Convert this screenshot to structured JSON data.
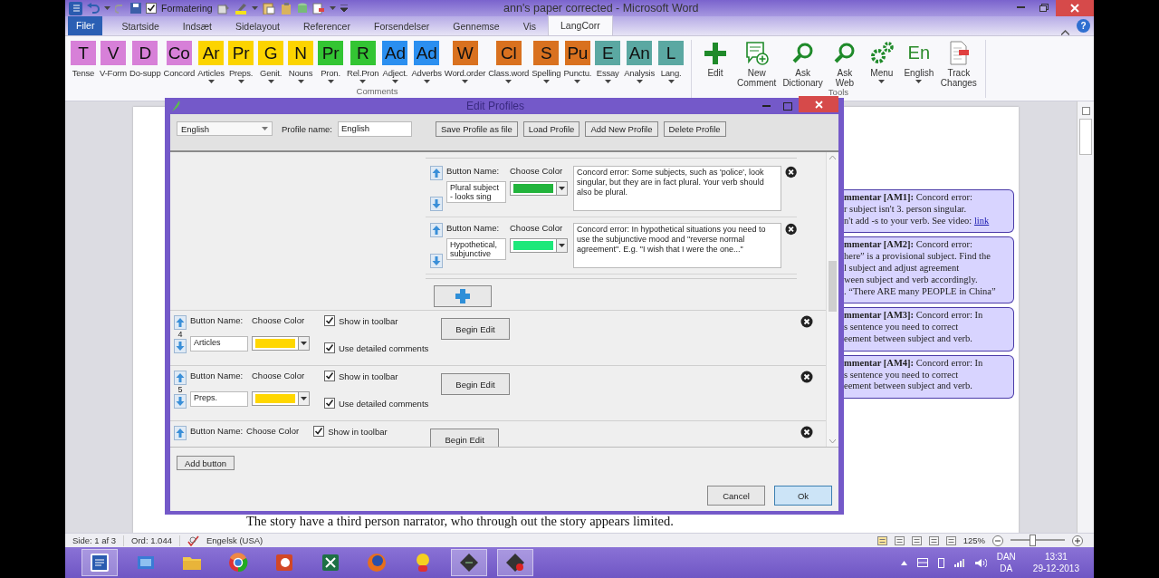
{
  "titlebar": {
    "qat_label": "Formatering",
    "qat_checked": true,
    "title": "ann's paper corrected  -  Microsoft Word"
  },
  "tabs": [
    {
      "label": "Filer",
      "kind": "file",
      "selected": false
    },
    {
      "label": "Startside",
      "kind": "tab",
      "selected": false
    },
    {
      "label": "Indsæt",
      "kind": "tab",
      "selected": false
    },
    {
      "label": "Sidelayout",
      "kind": "tab",
      "selected": false
    },
    {
      "label": "Referencer",
      "kind": "tab",
      "selected": false
    },
    {
      "label": "Forsendelser",
      "kind": "tab",
      "selected": false
    },
    {
      "label": "Gennemse",
      "kind": "tab",
      "selected": false
    },
    {
      "label": "Vis",
      "kind": "tab",
      "selected": false
    },
    {
      "label": "LangCorr",
      "kind": "tab",
      "selected": true
    }
  ],
  "help": "?",
  "ribbon": {
    "comments_group": "Comments",
    "tools_group": "Tools",
    "comment_buttons": [
      {
        "letter": "T",
        "label": "Tense",
        "color": "#d780d8",
        "dropdown": false
      },
      {
        "letter": "V",
        "label": "V-Form",
        "color": "#d780d8",
        "dropdown": false
      },
      {
        "letter": "D",
        "label": "Do-supp",
        "color": "#d780d8",
        "dropdown": false
      },
      {
        "letter": "Co",
        "label": "Concord",
        "color": "#d780d8",
        "dropdown": false
      },
      {
        "letter": "Ar",
        "label": "Articles",
        "color": "#fcd400",
        "dropdown": true
      },
      {
        "letter": "Pr",
        "label": "Preps.",
        "color": "#fcd400",
        "dropdown": true
      },
      {
        "letter": "G",
        "label": "Genit.",
        "color": "#fcd400",
        "dropdown": true
      },
      {
        "letter": "N",
        "label": "Nouns",
        "color": "#fcd400",
        "dropdown": true
      },
      {
        "letter": "Pr",
        "label": "Pron.",
        "color": "#33c533",
        "dropdown": true
      },
      {
        "letter": "R",
        "label": "Rel.Pron",
        "color": "#33c533",
        "dropdown": true
      },
      {
        "letter": "Ad",
        "label": "Adject.",
        "color": "#2b8ff0",
        "dropdown": true
      },
      {
        "letter": "Ad",
        "label": "Adverbs",
        "color": "#2b8ff0",
        "dropdown": true
      },
      {
        "letter": "W",
        "label": "Word.order",
        "color": "#d9711f",
        "dropdown": true
      },
      {
        "letter": "Cl",
        "label": "Class.word",
        "color": "#d9711f",
        "dropdown": true
      },
      {
        "letter": "S",
        "label": "Spelling",
        "color": "#d9711f",
        "dropdown": true
      },
      {
        "letter": "Pu",
        "label": "Punctu.",
        "color": "#d9711f",
        "dropdown": true
      },
      {
        "letter": "E",
        "label": "Essay",
        "color": "#5ba8a2",
        "dropdown": true
      },
      {
        "letter": "An",
        "label": "Analysis",
        "color": "#5ba8a2",
        "dropdown": true
      },
      {
        "letter": "L",
        "label": "Lang.",
        "color": "#5ba8a2",
        "dropdown": true
      }
    ],
    "tools": [
      {
        "kind": "plus",
        "label": "Edit",
        "dropdown": false
      },
      {
        "kind": "comment",
        "label": "New\nComment",
        "dropdown": false
      },
      {
        "kind": "search",
        "label": "Ask\nDictionary",
        "dropdown": false
      },
      {
        "kind": "search",
        "label": "Ask\nWeb",
        "dropdown": false
      },
      {
        "kind": "gears",
        "label": "Menu",
        "dropdown": true
      },
      {
        "kind": "text",
        "icon_text": "En",
        "label": "English",
        "dropdown": true
      },
      {
        "kind": "track",
        "label": "Track\nChanges",
        "dropdown": false
      }
    ]
  },
  "document": {
    "comments": [
      {
        "lines": [
          "**mmentar [AM1]:** Concord error:",
          "r subject isn't 3. person singular.",
          "n't add -s to your verb. See video:"
        ],
        "link": "link"
      },
      {
        "lines": [
          "**mmentar [AM2]:** Concord error:",
          "here” is a provisional subject. Find the",
          "l subject and adjust agreement",
          "ween subject and verb accordingly.",
          ". “There ARE many PEOPLE in China”"
        ]
      },
      {
        "lines": [
          "**mmentar [AM3]:** Concord error: In",
          "s sentence you need to correct",
          "eement between subject and verb."
        ]
      },
      {
        "lines": [
          "**mmentar [AM4]:** Concord error: In",
          "s sentence you need to correct",
          "eement between subject and verb."
        ]
      }
    ],
    "sentence": "The story have a third person narrator, who through out the story appears limited."
  },
  "dialog": {
    "title": "Edit Profiles",
    "profile_select": "English",
    "profile_label": "Profile name:",
    "profile_name": "English",
    "actions": [
      "Save Profile as file",
      "Load Profile",
      "Add New Profile",
      "Delete Profile"
    ],
    "sub_entries": [
      {
        "label_name": "Button Name:",
        "label_color": "Choose Color",
        "name": "Plural subject - looks sing",
        "color": "#22b43c",
        "comment": "Concord error: Some subjects, such as 'police', look singular, but they are in fact plural. Your verb should also be plural."
      },
      {
        "label_name": "Button Name:",
        "label_color": "Choose Color",
        "name": "Hypothetical, subjunctive",
        "color": "#1ee87a",
        "comment": "Concord error: In hypothetical situations you need to use the subjunctive mood and \"reverse normal agreement\". E.g. \"I wish that I were the one...\""
      }
    ],
    "entries": [
      {
        "number": "4",
        "label_name": "Button Name:",
        "label_color": "Choose Color",
        "name": "Articles",
        "color": "#ffd700",
        "show_in_toolbar": {
          "label": "Show in toolbar",
          "checked": true
        },
        "detailed": {
          "label": "Use detailed comments",
          "checked": true
        },
        "action": "Begin Edit"
      },
      {
        "number": "5",
        "label_name": "Button Name:",
        "label_color": "Choose Color",
        "name": "Preps.",
        "color": "#ffd700",
        "show_in_toolbar": {
          "label": "Show in toolbar",
          "checked": true
        },
        "detailed": {
          "label": "Use detailed comments",
          "checked": true
        },
        "action": "Begin Edit"
      },
      {
        "label_name": "Button Name:",
        "label_color": "Choose Color",
        "show_in_toolbar": {
          "label": "Show in toolbar",
          "checked": true
        },
        "action": "Begin Edit"
      }
    ],
    "add_button": "Add button",
    "buttons": [
      {
        "label": "Cancel",
        "focused": false
      },
      {
        "label": "Ok",
        "focused": true
      }
    ]
  },
  "status": {
    "page": "Side: 1 af 3",
    "words": "Ord: 1.044",
    "language": "Engelsk (USA)",
    "zoom": "125%",
    "zoom_slider": {
      "level": 0.4
    }
  },
  "tray": {
    "lang_top": "DAN",
    "lang_bottom": "DA",
    "time": "13:31",
    "date": "29-12-2013"
  }
}
